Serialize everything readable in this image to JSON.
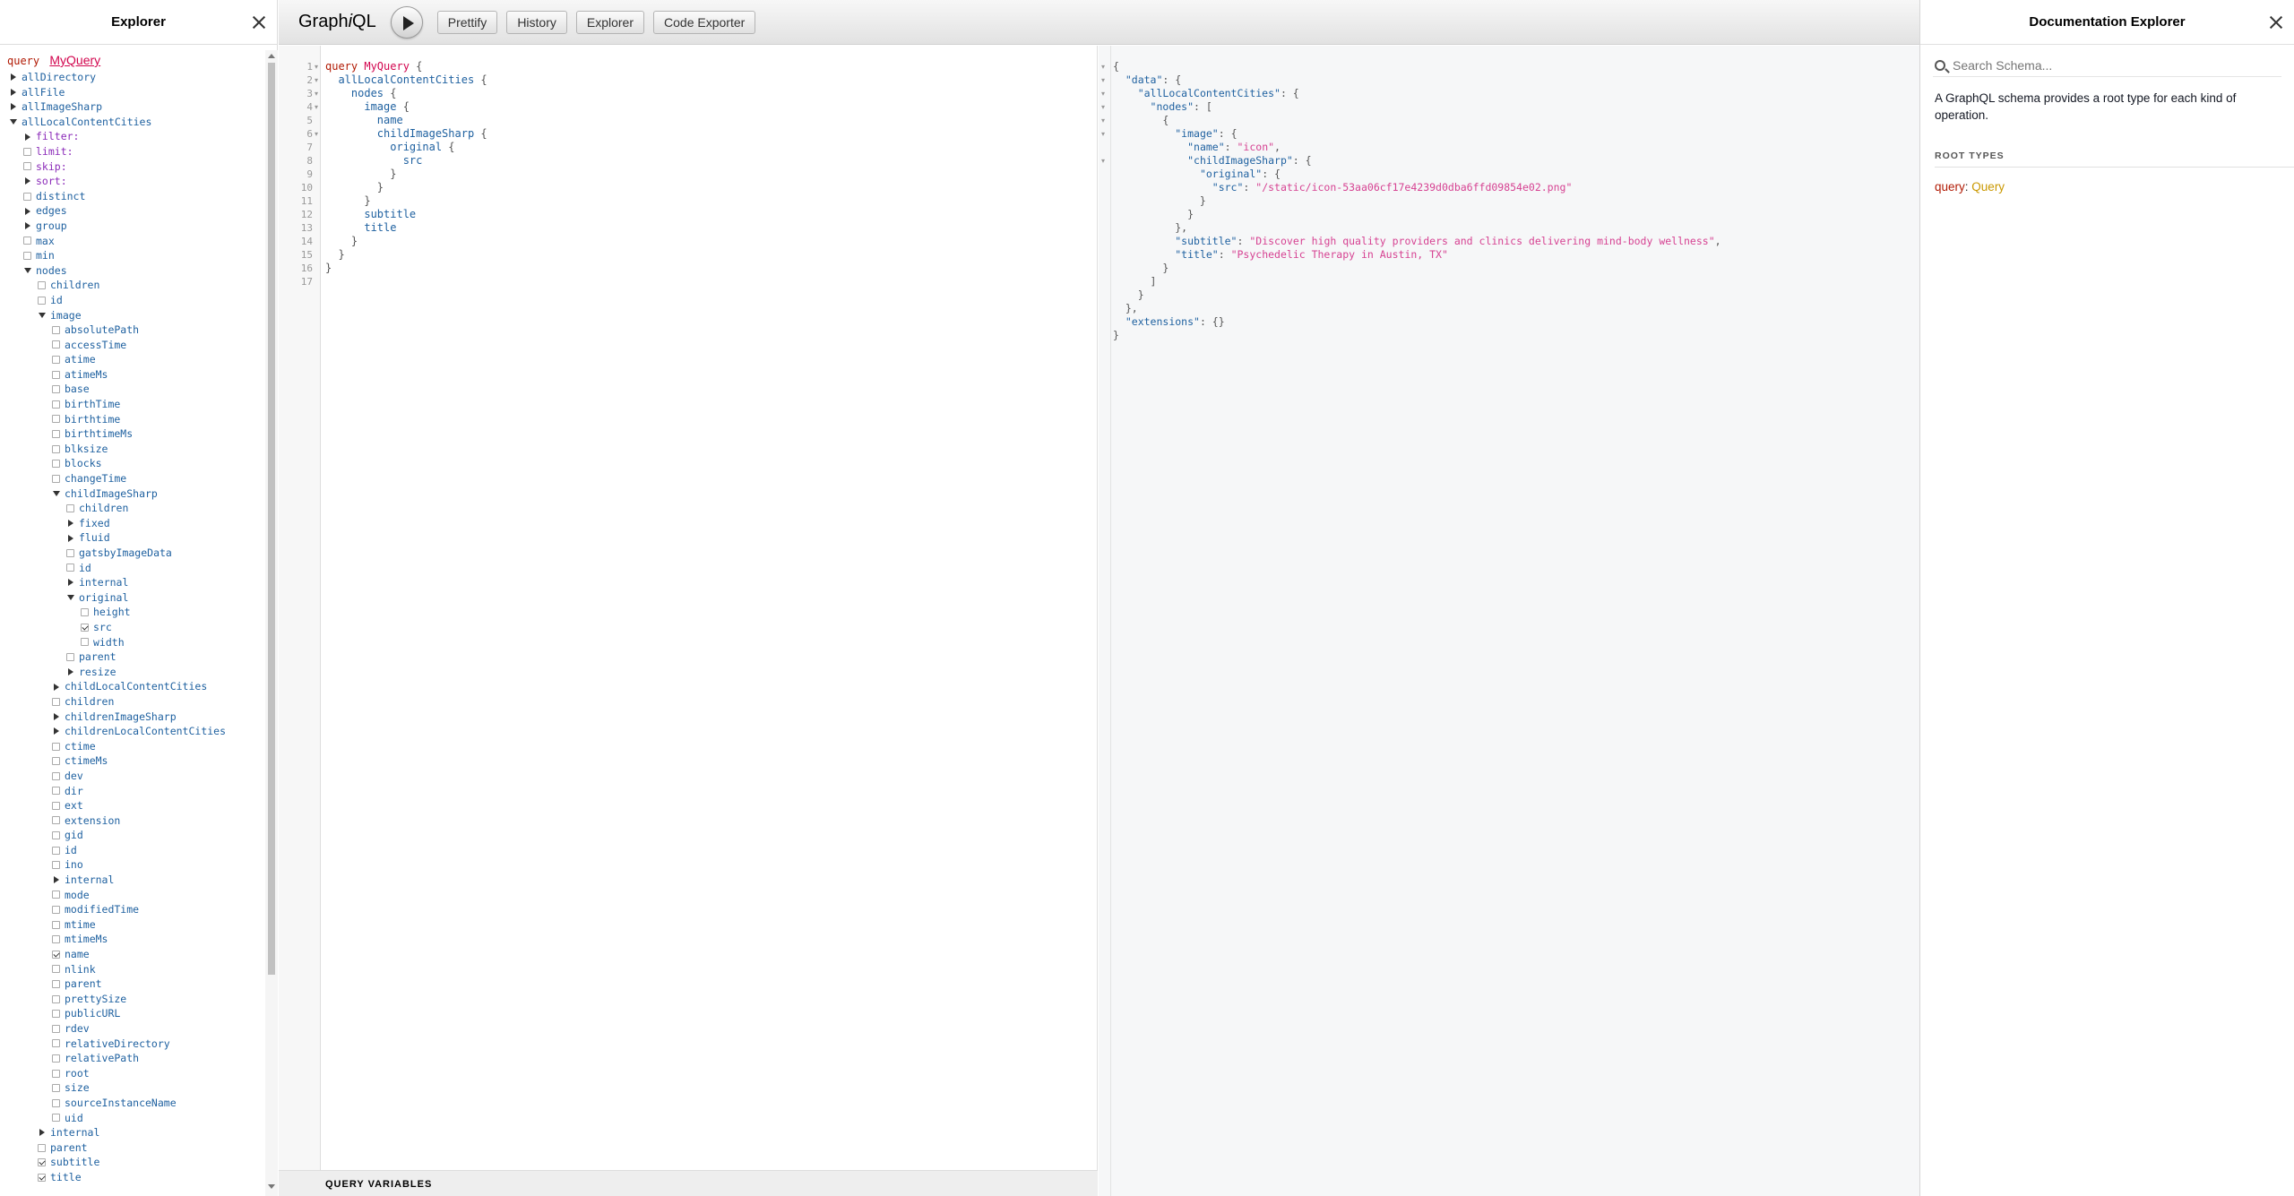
{
  "explorer": {
    "title": "Explorer",
    "query_keyword": "query",
    "query_name": "MyQuery",
    "tree": [
      {
        "label": "allDirectory",
        "d": 0,
        "c": "ar"
      },
      {
        "label": "allFile",
        "d": 0,
        "c": "ar"
      },
      {
        "label": "allImageSharp",
        "d": 0,
        "c": "ar"
      },
      {
        "label": "allLocalContentCities",
        "d": 0,
        "c": "ad"
      },
      {
        "label": "filter:",
        "d": 1,
        "c": "ar",
        "arg": true
      },
      {
        "label": "limit:",
        "d": 1,
        "c": "cb",
        "arg": true
      },
      {
        "label": "skip:",
        "d": 1,
        "c": "cb",
        "arg": true
      },
      {
        "label": "sort:",
        "d": 1,
        "c": "ar",
        "arg": true
      },
      {
        "label": "distinct",
        "d": 1,
        "c": "cb"
      },
      {
        "label": "edges",
        "d": 1,
        "c": "ar"
      },
      {
        "label": "group",
        "d": 1,
        "c": "ar"
      },
      {
        "label": "max",
        "d": 1,
        "c": "cb"
      },
      {
        "label": "min",
        "d": 1,
        "c": "cb"
      },
      {
        "label": "nodes",
        "d": 1,
        "c": "ad"
      },
      {
        "label": "children",
        "d": 2,
        "c": "cb"
      },
      {
        "label": "id",
        "d": 2,
        "c": "cb"
      },
      {
        "label": "image",
        "d": 2,
        "c": "ad"
      },
      {
        "label": "absolutePath",
        "d": 3,
        "c": "cb"
      },
      {
        "label": "accessTime",
        "d": 3,
        "c": "cb"
      },
      {
        "label": "atime",
        "d": 3,
        "c": "cb"
      },
      {
        "label": "atimeMs",
        "d": 3,
        "c": "cb"
      },
      {
        "label": "base",
        "d": 3,
        "c": "cb"
      },
      {
        "label": "birthTime",
        "d": 3,
        "c": "cb"
      },
      {
        "label": "birthtime",
        "d": 3,
        "c": "cb"
      },
      {
        "label": "birthtimeMs",
        "d": 3,
        "c": "cb"
      },
      {
        "label": "blksize",
        "d": 3,
        "c": "cb"
      },
      {
        "label": "blocks",
        "d": 3,
        "c": "cb"
      },
      {
        "label": "changeTime",
        "d": 3,
        "c": "cb"
      },
      {
        "label": "childImageSharp",
        "d": 3,
        "c": "ad"
      },
      {
        "label": "children",
        "d": 4,
        "c": "cb"
      },
      {
        "label": "fixed",
        "d": 4,
        "c": "ar"
      },
      {
        "label": "fluid",
        "d": 4,
        "c": "ar"
      },
      {
        "label": "gatsbyImageData",
        "d": 4,
        "c": "cb"
      },
      {
        "label": "id",
        "d": 4,
        "c": "cb"
      },
      {
        "label": "internal",
        "d": 4,
        "c": "ar"
      },
      {
        "label": "original",
        "d": 4,
        "c": "ad"
      },
      {
        "label": "height",
        "d": 5,
        "c": "cb"
      },
      {
        "label": "src",
        "d": 5,
        "c": "cb",
        "on": true
      },
      {
        "label": "width",
        "d": 5,
        "c": "cb"
      },
      {
        "label": "parent",
        "d": 4,
        "c": "cb"
      },
      {
        "label": "resize",
        "d": 4,
        "c": "ar"
      },
      {
        "label": "childLocalContentCities",
        "d": 3,
        "c": "ar"
      },
      {
        "label": "children",
        "d": 3,
        "c": "cb"
      },
      {
        "label": "childrenImageSharp",
        "d": 3,
        "c": "ar"
      },
      {
        "label": "childrenLocalContentCities",
        "d": 3,
        "c": "ar"
      },
      {
        "label": "ctime",
        "d": 3,
        "c": "cb"
      },
      {
        "label": "ctimeMs",
        "d": 3,
        "c": "cb"
      },
      {
        "label": "dev",
        "d": 3,
        "c": "cb"
      },
      {
        "label": "dir",
        "d": 3,
        "c": "cb"
      },
      {
        "label": "ext",
        "d": 3,
        "c": "cb"
      },
      {
        "label": "extension",
        "d": 3,
        "c": "cb"
      },
      {
        "label": "gid",
        "d": 3,
        "c": "cb"
      },
      {
        "label": "id",
        "d": 3,
        "c": "cb"
      },
      {
        "label": "ino",
        "d": 3,
        "c": "cb"
      },
      {
        "label": "internal",
        "d": 3,
        "c": "ar"
      },
      {
        "label": "mode",
        "d": 3,
        "c": "cb"
      },
      {
        "label": "modifiedTime",
        "d": 3,
        "c": "cb"
      },
      {
        "label": "mtime",
        "d": 3,
        "c": "cb"
      },
      {
        "label": "mtimeMs",
        "d": 3,
        "c": "cb"
      },
      {
        "label": "name",
        "d": 3,
        "c": "cb",
        "on": true
      },
      {
        "label": "nlink",
        "d": 3,
        "c": "cb"
      },
      {
        "label": "parent",
        "d": 3,
        "c": "cb"
      },
      {
        "label": "prettySize",
        "d": 3,
        "c": "cb"
      },
      {
        "label": "publicURL",
        "d": 3,
        "c": "cb"
      },
      {
        "label": "rdev",
        "d": 3,
        "c": "cb"
      },
      {
        "label": "relativeDirectory",
        "d": 3,
        "c": "cb"
      },
      {
        "label": "relativePath",
        "d": 3,
        "c": "cb"
      },
      {
        "label": "root",
        "d": 3,
        "c": "cb"
      },
      {
        "label": "size",
        "d": 3,
        "c": "cb"
      },
      {
        "label": "sourceInstanceName",
        "d": 3,
        "c": "cb"
      },
      {
        "label": "uid",
        "d": 3,
        "c": "cb"
      },
      {
        "label": "internal",
        "d": 2,
        "c": "ar"
      },
      {
        "label": "parent",
        "d": 2,
        "c": "cb"
      },
      {
        "label": "subtitle",
        "d": 2,
        "c": "cb",
        "on": true
      },
      {
        "label": "title",
        "d": 2,
        "c": "cb",
        "on": true
      }
    ]
  },
  "toolbar": {
    "logo_pre": "Graph",
    "logo_i": "i",
    "logo_post": "QL",
    "prettify": "Prettify",
    "history": "History",
    "explorer": "Explorer",
    "code_exporter": "Code Exporter"
  },
  "editor": {
    "query_variables_label": "QUERY VARIABLES",
    "lines": [
      [
        [
          "c-kw",
          "query "
        ],
        [
          "c-def",
          "MyQuery"
        ],
        [
          "c-p",
          " {"
        ]
      ],
      [
        [
          "c-p",
          "  "
        ],
        [
          "c-prop",
          "allLocalContentCities"
        ],
        [
          "c-p",
          " {"
        ]
      ],
      [
        [
          "c-p",
          "    "
        ],
        [
          "c-prop",
          "nodes"
        ],
        [
          "c-p",
          " {"
        ]
      ],
      [
        [
          "c-p",
          "      "
        ],
        [
          "c-prop",
          "image"
        ],
        [
          "c-p",
          " {"
        ]
      ],
      [
        [
          "c-p",
          "        "
        ],
        [
          "c-prop",
          "name"
        ]
      ],
      [
        [
          "c-p",
          "        "
        ],
        [
          "c-prop",
          "childImageSharp"
        ],
        [
          "c-p",
          " {"
        ]
      ],
      [
        [
          "c-p",
          "          "
        ],
        [
          "c-prop",
          "original"
        ],
        [
          "c-p",
          " {"
        ]
      ],
      [
        [
          "c-p",
          "            "
        ],
        [
          "c-prop",
          "src"
        ]
      ],
      [
        [
          "c-p",
          "          }"
        ]
      ],
      [
        [
          "c-p",
          "        }"
        ]
      ],
      [
        [
          "c-p",
          "      }"
        ]
      ],
      [
        [
          "c-p",
          "      "
        ],
        [
          "c-prop",
          "subtitle"
        ]
      ],
      [
        [
          "c-p",
          "      "
        ],
        [
          "c-prop",
          "title"
        ]
      ],
      [
        [
          "c-p",
          "    }"
        ]
      ],
      [
        [
          "c-p",
          "  }"
        ]
      ],
      [
        [
          "c-p",
          "}"
        ]
      ],
      [
        [
          "c-p",
          ""
        ]
      ]
    ],
    "fold_lines": [
      1,
      2,
      3,
      4,
      6
    ]
  },
  "result": {
    "lines": [
      [
        [
          "",
          "{"
        ]
      ],
      [
        [
          "",
          "  "
        ],
        [
          "r-key",
          "\"data\""
        ],
        [
          "",
          ": {"
        ]
      ],
      [
        [
          "",
          "    "
        ],
        [
          "r-key",
          "\"allLocalContentCities\""
        ],
        [
          "",
          ": {"
        ]
      ],
      [
        [
          "",
          "      "
        ],
        [
          "r-key",
          "\"nodes\""
        ],
        [
          "",
          ": ["
        ]
      ],
      [
        [
          "",
          "        {"
        ]
      ],
      [
        [
          "",
          "          "
        ],
        [
          "r-key",
          "\"image\""
        ],
        [
          "",
          ": {"
        ]
      ],
      [
        [
          "",
          "            "
        ],
        [
          "r-key",
          "\"name\""
        ],
        [
          "",
          ": "
        ],
        [
          "r-str",
          "\"icon\""
        ],
        [
          "",
          ","
        ]
      ],
      [
        [
          "",
          "            "
        ],
        [
          "r-key",
          "\"childImageSharp\""
        ],
        [
          "",
          ": {"
        ]
      ],
      [
        [
          "",
          "              "
        ],
        [
          "r-key",
          "\"original\""
        ],
        [
          "",
          ": {"
        ]
      ],
      [
        [
          "",
          "                "
        ],
        [
          "r-key",
          "\"src\""
        ],
        [
          "",
          ": "
        ],
        [
          "r-str",
          "\"/static/icon-53aa06cf17e4239d0dba6ffd09854e02.png\""
        ]
      ],
      [
        [
          "",
          "              }"
        ]
      ],
      [
        [
          "",
          "            }"
        ]
      ],
      [
        [
          "",
          "          },"
        ]
      ],
      [
        [
          "",
          "          "
        ],
        [
          "r-key",
          "\"subtitle\""
        ],
        [
          "",
          ": "
        ],
        [
          "r-str",
          "\"Discover high quality providers and clinics delivering mind-body wellness\""
        ],
        [
          "",
          ","
        ]
      ],
      [
        [
          "",
          "          "
        ],
        [
          "r-key",
          "\"title\""
        ],
        [
          "",
          ": "
        ],
        [
          "r-str",
          "\"Psychedelic Therapy in Austin, TX\""
        ]
      ],
      [
        [
          "",
          "        }"
        ]
      ],
      [
        [
          "",
          "      ]"
        ]
      ],
      [
        [
          "",
          "    }"
        ]
      ],
      [
        [
          "",
          "  },"
        ]
      ],
      [
        [
          "",
          "  "
        ],
        [
          "r-key",
          "\"extensions\""
        ],
        [
          "",
          ": {}"
        ]
      ],
      [
        [
          "",
          "}"
        ]
      ]
    ],
    "fold_lines": [
      1,
      2,
      3,
      4,
      5,
      6,
      8
    ]
  },
  "docs": {
    "title": "Documentation Explorer",
    "search_placeholder": "Search Schema...",
    "description": "A GraphQL schema provides a root type for each kind of operation.",
    "root_types_label": "ROOT TYPES",
    "query_field": "query",
    "query_type": "Query"
  }
}
